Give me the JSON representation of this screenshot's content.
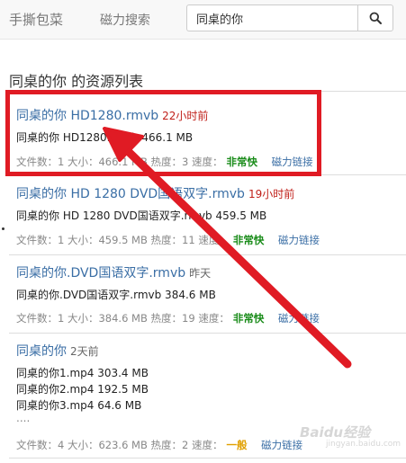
{
  "navbar": {
    "brand": "手撕包菜",
    "nav_link": "磁力搜索",
    "search_value": "同桌的你",
    "search_icon": "search-icon"
  },
  "heading": "同桌的你 的资源列表",
  "meta_labels": {
    "file_count": "文件数：",
    "size": "大小：",
    "heat": "热度：",
    "speed": "速度：",
    "magnet": "磁力链接"
  },
  "results": [
    {
      "title": "同桌的你 HD1280.rmvb",
      "time": "22小时前",
      "files": [
        "同桌的你 HD1280.rmvb 466.1 MB"
      ],
      "file_count": "1",
      "size": "466.1 MB",
      "heat": "3",
      "speed": "非常快"
    },
    {
      "title": "同桌的你 HD 1280 DVD国语双字.rmvb",
      "time": "19小时前",
      "files": [
        "同桌的你 HD 1280 DVD国语双字.rmvb 459.5 MB"
      ],
      "file_count": "1",
      "size": "459.5 MB",
      "heat": "11",
      "speed": "非常快"
    },
    {
      "title": "同桌的你.DVD国语双字.rmvb",
      "time": "昨天",
      "files": [
        "同桌的你.DVD国语双字.rmvb 384.6 MB"
      ],
      "file_count": "1",
      "size": "384.6 MB",
      "heat": "19",
      "speed": "非常快"
    },
    {
      "title": "同桌的你",
      "time": "2天前",
      "files": [
        "同桌的你1.mp4 303.4 MB",
        "同桌的你2.mp4 192.5 MB",
        "同桌的你3.mp4 64.6 MB",
        "...."
      ],
      "file_count": "4",
      "size": "623.6 MB",
      "heat": "2",
      "speed": "一般"
    }
  ],
  "annotation": {
    "color": "#e01b24"
  },
  "watermark": {
    "main": "Baidu经验",
    "sub": "jingyan.baidu.com"
  }
}
